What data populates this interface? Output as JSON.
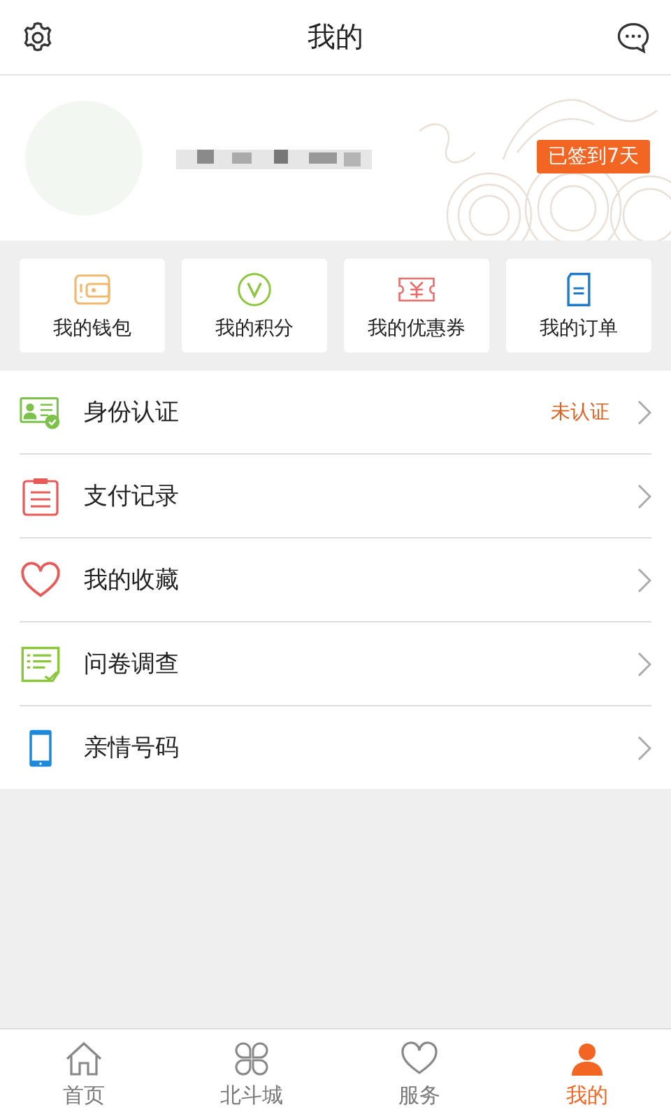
{
  "header": {
    "title": "我的"
  },
  "profile": {
    "checkin_badge": "已签到7天"
  },
  "shortcuts": [
    {
      "kind": "wallet",
      "label": "我的钱包"
    },
    {
      "kind": "points",
      "label": "我的积分"
    },
    {
      "kind": "coupon",
      "label": "我的优惠券"
    },
    {
      "kind": "order",
      "label": "我的订单"
    }
  ],
  "menu": [
    {
      "kind": "id",
      "label": "身份认证",
      "status": "未认证"
    },
    {
      "kind": "payment",
      "label": "支付记录"
    },
    {
      "kind": "favorite",
      "label": "我的收藏"
    },
    {
      "kind": "survey",
      "label": "问卷调查"
    },
    {
      "kind": "phone",
      "label": "亲情号码"
    }
  ],
  "tab_bar": [
    {
      "kind": "home",
      "label": "首页",
      "selected": false
    },
    {
      "kind": "mall",
      "label": "北斗城",
      "selected": false
    },
    {
      "kind": "service",
      "label": "服务",
      "selected": false
    },
    {
      "kind": "me",
      "label": "我的",
      "selected": true
    }
  ]
}
